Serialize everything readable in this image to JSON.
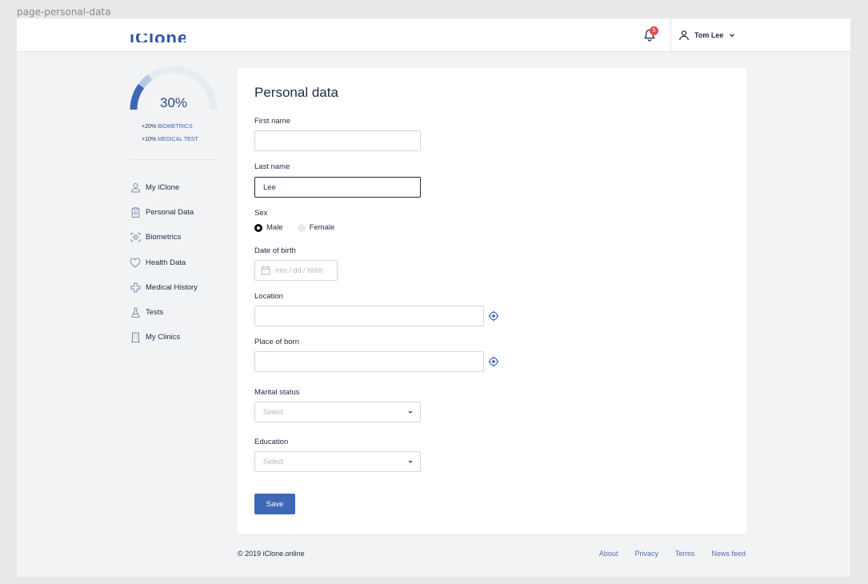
{
  "frame_label": "page-personal-data",
  "brand": {
    "logo_text": "iClone",
    "accent": "#3f67b8",
    "accent_light": "#b7c7e6",
    "badge_color": "#e5494d"
  },
  "header": {
    "notification_count": "5",
    "user_name": "Tom Lee",
    "icons": {
      "notifications": "bell-icon",
      "user": "user-icon",
      "dropdown": "chevron-down-icon"
    }
  },
  "progress": {
    "percent_label": "30%",
    "value": 0.3,
    "segments": [
      {
        "fraction": 0.2,
        "color": "#3f67b8"
      },
      {
        "fraction": 0.1,
        "color": "#b7c7e6"
      }
    ],
    "bonuses": [
      {
        "amount": "+20%",
        "label": "BIOMETRICS"
      },
      {
        "amount": "+10%",
        "label": "MEDICAL TEST"
      }
    ]
  },
  "sidebar": {
    "items": [
      {
        "label": "My iClone",
        "icon": "user-icon"
      },
      {
        "label": "Personal Data",
        "icon": "clipboard-icon"
      },
      {
        "label": "Biometrics",
        "icon": "face-scan-icon"
      },
      {
        "label": "Health Data",
        "icon": "heart-icon"
      },
      {
        "label": "Medical History",
        "icon": "medical-cross-icon"
      },
      {
        "label": "Tests",
        "icon": "flask-icon"
      },
      {
        "label": "My Clinics",
        "icon": "building-icon"
      }
    ]
  },
  "form": {
    "title": "Personal data",
    "first_name": {
      "label": "First name",
      "value": ""
    },
    "last_name": {
      "label": "Last name",
      "value": "Lee"
    },
    "sex": {
      "label": "Sex",
      "options": [
        "Male",
        "Female"
      ],
      "selected": "Male"
    },
    "date_of_birth": {
      "label": "Date of birth",
      "placeholder": "mm / dd / hhhh",
      "icon": "calendar-icon"
    },
    "location": {
      "label": "Location",
      "value": "",
      "icon": "locate-icon"
    },
    "place_of_born": {
      "label": "Place of born",
      "value": "",
      "icon": "locate-icon"
    },
    "marital_status": {
      "label": "Marital status",
      "placeholder": "Select"
    },
    "education": {
      "label": "Education",
      "placeholder": "Select"
    },
    "save_label": "Save"
  },
  "footer": {
    "copyright": "© 2019 iClone.online",
    "links": [
      "About",
      "Privacy",
      "Terms",
      "News feed"
    ]
  }
}
